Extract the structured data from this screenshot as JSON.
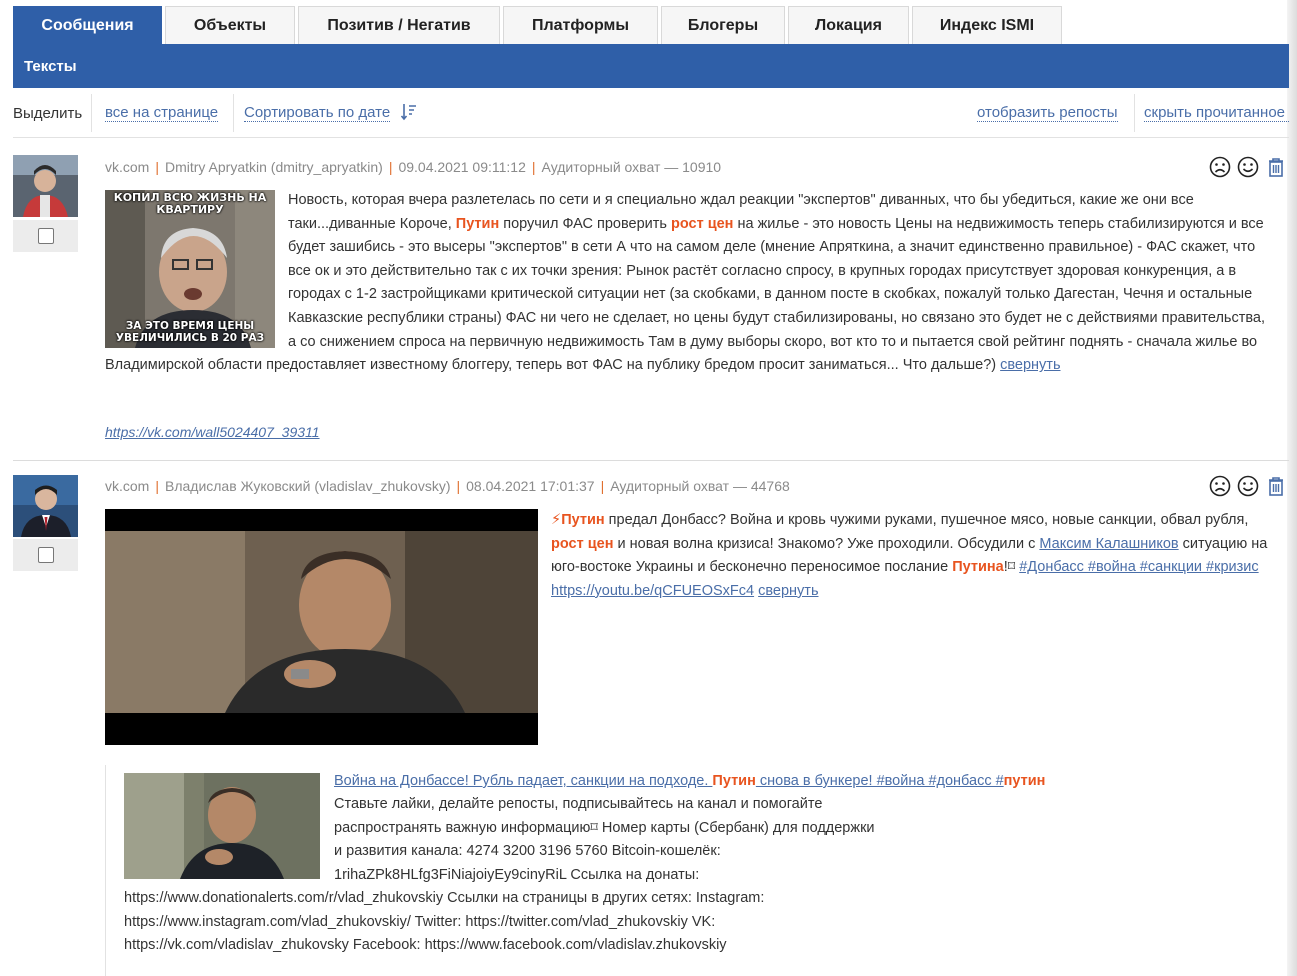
{
  "tabs": [
    {
      "label": "Сообщения",
      "active": true
    },
    {
      "label": "Объекты"
    },
    {
      "label": "Позитив / Негатив"
    },
    {
      "label": "Платформы"
    },
    {
      "label": "Блогеры"
    },
    {
      "label": "Локация"
    },
    {
      "label": "Индекс ISMI"
    }
  ],
  "subtab": {
    "label": "Тексты"
  },
  "toolbar": {
    "select_label": "Выделить",
    "select_all_label": "все на странице",
    "sort_label": "Сортировать по дате",
    "show_reposts_label": "отобразить репосты",
    "hide_read_label": "скрыть прочитанное"
  },
  "posts": [
    {
      "source": "vk.com",
      "author": "Dmitry Apryatkin (dmitry_apryatkin)",
      "datetime": "09.04.2021 09:11:12",
      "reach": "Аудиторный охват — 10910",
      "image_caption_top": "КОПИЛ ВСЮ ЖИЗНЬ НА КВАРТИРУ",
      "image_caption_bottom": "ЗА ЭТО ВРЕМЯ ЦЕНЫ УВЕЛИЧИЛИСЬ В 20 РАЗ",
      "text": {
        "t1": "Новость, которая вчера разлетелась по сети и я специально ждал реакции \"экспертов\" диванных, что бы убедиться, какие же они все таки...диванные Короче, ",
        "kw1": "Путин",
        "t2": " поручил ФАС проверить ",
        "kw2": "рост цен",
        "t3": " на жилье - это новость Цены на недвижимость теперь стабилизируются и все будет зашибись - это высеры \"экспертов\" в сети А что на самом деле (мнение Апряткина, а значит единственно правильное) - ФАС скажет, что все ок и это действительно так с их точки зрения: Рынок растёт согласно спросу, в крупных городах присутствует здоровая конкуренция, а в городах с 1-2 застройщиками критической ситуации нет (за скобками, в данном посте в скобках, пожалуй только Дагестан, Чечня и остальные Кавказские республики страны) ФАС ни чего не сделает, но цены будут стабилизированы, но связано это будет не с действиями правительства, а со снижением спроса на первичную недвижимость Там в думу выборы скоро, вот кто то и пытается свой рейтинг поднять - сначала жилье во Владимирской области предоставляет известному блоггеру, теперь вот ФАС на публику бредом просит заниматься... Что дальше?) ",
        "collapse": "свернуть"
      },
      "url": "https://vk.com/wall5024407_39311"
    },
    {
      "source": "vk.com",
      "author": "Владислав Жуковский (vladislav_zhukovsky)",
      "datetime": "08.04.2021 17:01:37",
      "reach": "Аудиторный охват — 44768",
      "text": {
        "bolt": "⚡",
        "kw1": "Путин",
        "t1": " предал Донбасс? Война и кровь чужими руками, пушечное мясо, новые санкции, обвал рубля, ",
        "kw2": "рост цен",
        "t2": " и новая волна кризиса! Знакомо? Уже проходили. Обсудили с ",
        "link1": "Максим Калашников",
        "t3": " ситуацию на юго-востоке Украины и бесконечно переносимое послание ",
        "kw3": "Путина",
        "t4": "!⌑ ",
        "tags": "#Донбасс #война #санкции #кризис",
        "yt": "https://youtu.be/qCFUEOSxFc4",
        "collapse": "свернуть"
      },
      "repost": {
        "title_a": "Война на Донбассе! Рубль падает, санкции на подходе. ",
        "title_kw": "Путин",
        "title_b": " снова в бункере! #война #донбасс #",
        "title_kw2": "путин",
        "body1": "Ставьте лайки, делайте репосты, подписывайтесь на канал и помогайте",
        "body2": "распространять важную информацию⌑ Номер карты (Сбербанк) для поддержки",
        "body3": "и развития канала: 4274 3200 3196 5760 Bitcoin-кошелёк:",
        "body4": "1rihaZPk8HLfg3FiNiajoiyEy9cinyRiL Ссылка на донаты:",
        "body5": "https://www.donationalerts.com/r/vlad_zhukovskiy Ссылки на страницы в других сетях: Instagram:",
        "body6": "https://www.instagram.com/vlad_zhukovskiy/ Twitter: https://twitter.com/vlad_zhukovskiy VK:",
        "body7": "https://vk.com/vladislav_zhukovsky Facebook: https://www.facebook.com/vladislav.zhukovskiy"
      }
    }
  ],
  "icons": [
    "frown-icon",
    "smile-icon",
    "trash-icon",
    "sort-desc-icon",
    "checkbox-icon"
  ],
  "colors": {
    "accent": "#2f5fa8",
    "keyword": "#e8541f",
    "link": "#4a6ea8",
    "separator": "#e07030"
  }
}
